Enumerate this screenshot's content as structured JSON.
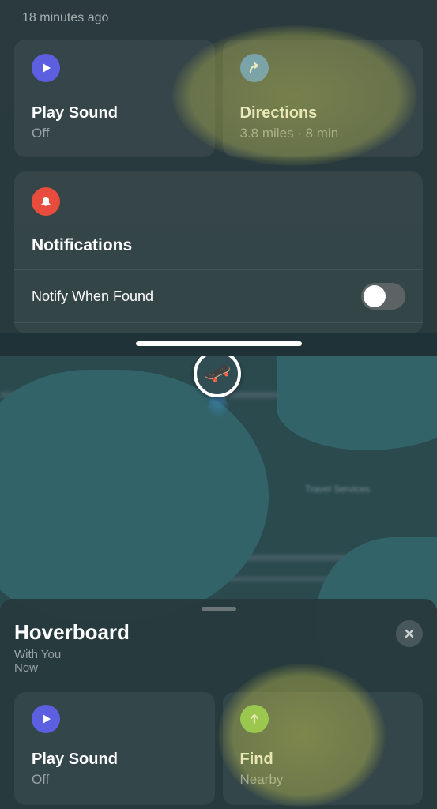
{
  "top": {
    "timestamp": "18 minutes ago",
    "playSound": {
      "title": "Play Sound",
      "sub": "Off"
    },
    "directions": {
      "title": "Directions",
      "sub": "3.8 miles · 8 min"
    }
  },
  "notifications": {
    "title": "Notifications",
    "rows": [
      {
        "label": "Notify When Found",
        "toggled": false
      }
    ],
    "cutoff": {
      "label": "Notify When Left Behind",
      "value": "Off"
    }
  },
  "map": {
    "pin_emoji": "🛹",
    "poi_label": "Travel Services"
  },
  "sheet": {
    "title": "Hoverboard",
    "sub1": "With You",
    "sub2": "Now",
    "playSound": {
      "title": "Play Sound",
      "sub": "Off"
    },
    "find": {
      "title": "Find",
      "sub": "Nearby"
    }
  }
}
